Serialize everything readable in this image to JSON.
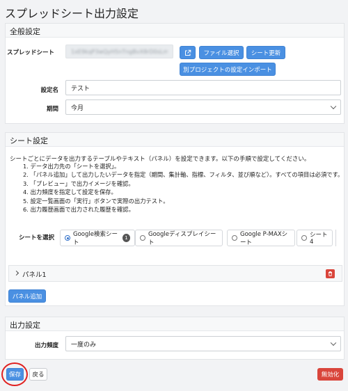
{
  "page": {
    "title": "スプレッドシート出力設定"
  },
  "general": {
    "heading": "全般設定",
    "spreadsheet_label": "スプレッドシート",
    "spreadsheet_id": "1xE9kqP3wQyH5nTngBvX8rD0sLm2",
    "buttons": {
      "file_select": "ファイル選択",
      "sheet_update": "シート更新",
      "import": "別プロジェクトの設定インポート"
    },
    "setting_name_label": "設定名",
    "setting_name_value": "テスト",
    "period_label": "期間",
    "period_value": "今月"
  },
  "sheet": {
    "heading": "シート設定",
    "description": "シートごとにデータを出力するテーブルやテキスト（パネル）を設定できます。以下の手順で設定してください。",
    "steps": [
      "1. データ出力先の「シートを選択」。",
      "2. 「パネル追加」して出力したいデータを指定（期間、集計軸、指標、フィルタ、並び順など）。すべての項目は必須です。",
      "3. 「プレビュー」で出力イメージを確認。",
      "4. 出力頻度を指定して設定を保存。",
      "5. 設定一覧画面の「実行」ボタンで実際の出力テスト。",
      "6. 出力履歴画面で出力された履歴を確認。"
    ],
    "select_label": "シートを選択",
    "tabs": [
      {
        "label": "Google検索シート",
        "badge": "1",
        "selected": true
      },
      {
        "label": "Googleディスプレイシート"
      },
      {
        "label": "Google P-MAXシート"
      },
      {
        "label": "シート4"
      }
    ],
    "panel_label": "パネル1",
    "add_panel": "パネル追加"
  },
  "output": {
    "heading": "出力設定",
    "frequency_label": "出力頻度",
    "frequency_value": "一度のみ"
  },
  "footer": {
    "save": "保存",
    "back": "戻る",
    "disable": "無効化"
  },
  "colors": {
    "primary": "#4a90e2",
    "danger": "#d9453b",
    "highlight": "#e02020"
  }
}
